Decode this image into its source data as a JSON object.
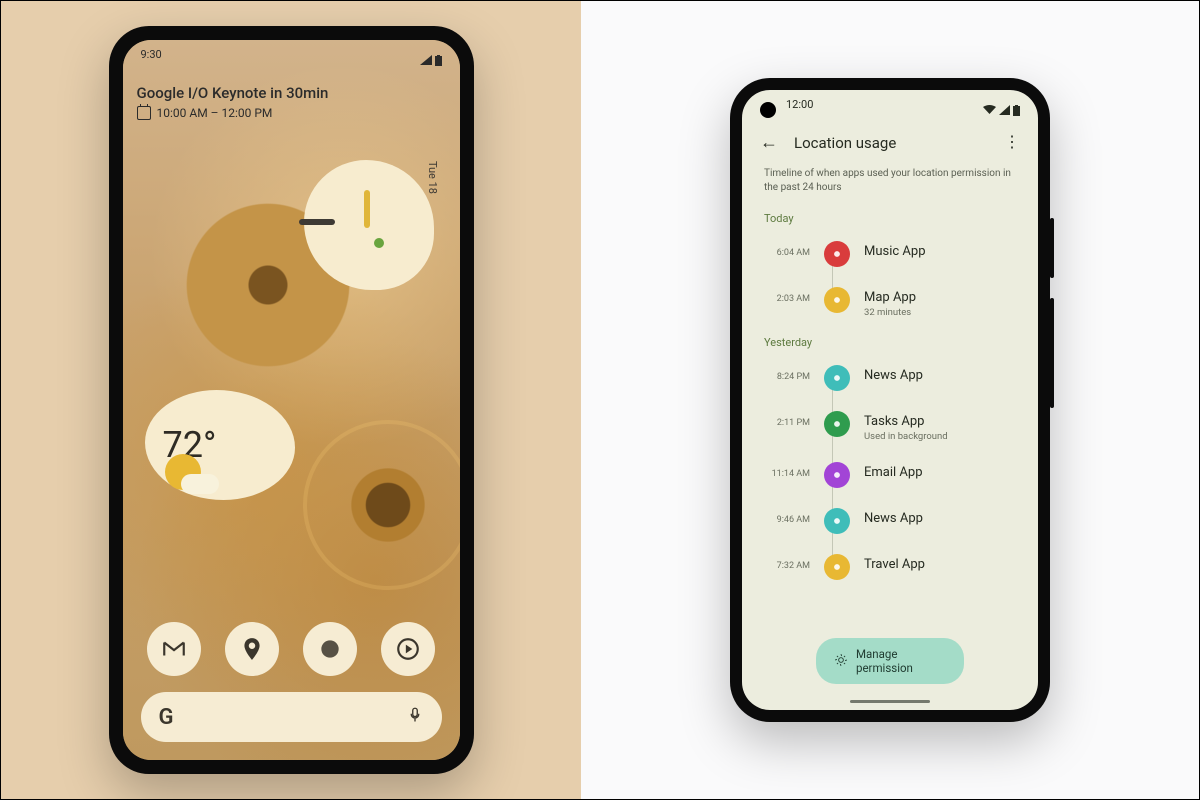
{
  "left_phone": {
    "status_time": "9:30",
    "calendar": {
      "title": "Google I/O Keynote in 30min",
      "time_range": "10:00 AM – 12:00 PM"
    },
    "clock": {
      "day": "Tue",
      "date": "18"
    },
    "weather": {
      "temperature": "72°"
    },
    "apps": [
      "gmail",
      "maps",
      "photos",
      "youtube-music"
    ],
    "search": {
      "logo": "G"
    }
  },
  "right_phone": {
    "status_time": "12:00",
    "header": "Location usage",
    "description": "Timeline of when apps used your location permission in the past 24 hours",
    "sections": [
      {
        "label": "Today",
        "entries": [
          {
            "time": "6:04 AM",
            "app": "Music App",
            "sub": "",
            "color": "#d93c3c"
          },
          {
            "time": "2:03 AM",
            "app": "Map App",
            "sub": "32 minutes",
            "color": "#e8b833"
          }
        ]
      },
      {
        "label": "Yesterday",
        "entries": [
          {
            "time": "8:24 PM",
            "app": "News App",
            "sub": "",
            "color": "#3fbdb9"
          },
          {
            "time": "2:11 PM",
            "app": "Tasks App",
            "sub": "Used in background",
            "color": "#2f9c4e"
          },
          {
            "time": "11:14 AM",
            "app": "Email App",
            "sub": "",
            "color": "#a244d6"
          },
          {
            "time": "9:46 AM",
            "app": "News App",
            "sub": "",
            "color": "#3fbdb9"
          },
          {
            "time": "7:32 AM",
            "app": "Travel App",
            "sub": "",
            "color": "#e8b833"
          }
        ]
      }
    ],
    "manage_button": "Manage permission"
  }
}
